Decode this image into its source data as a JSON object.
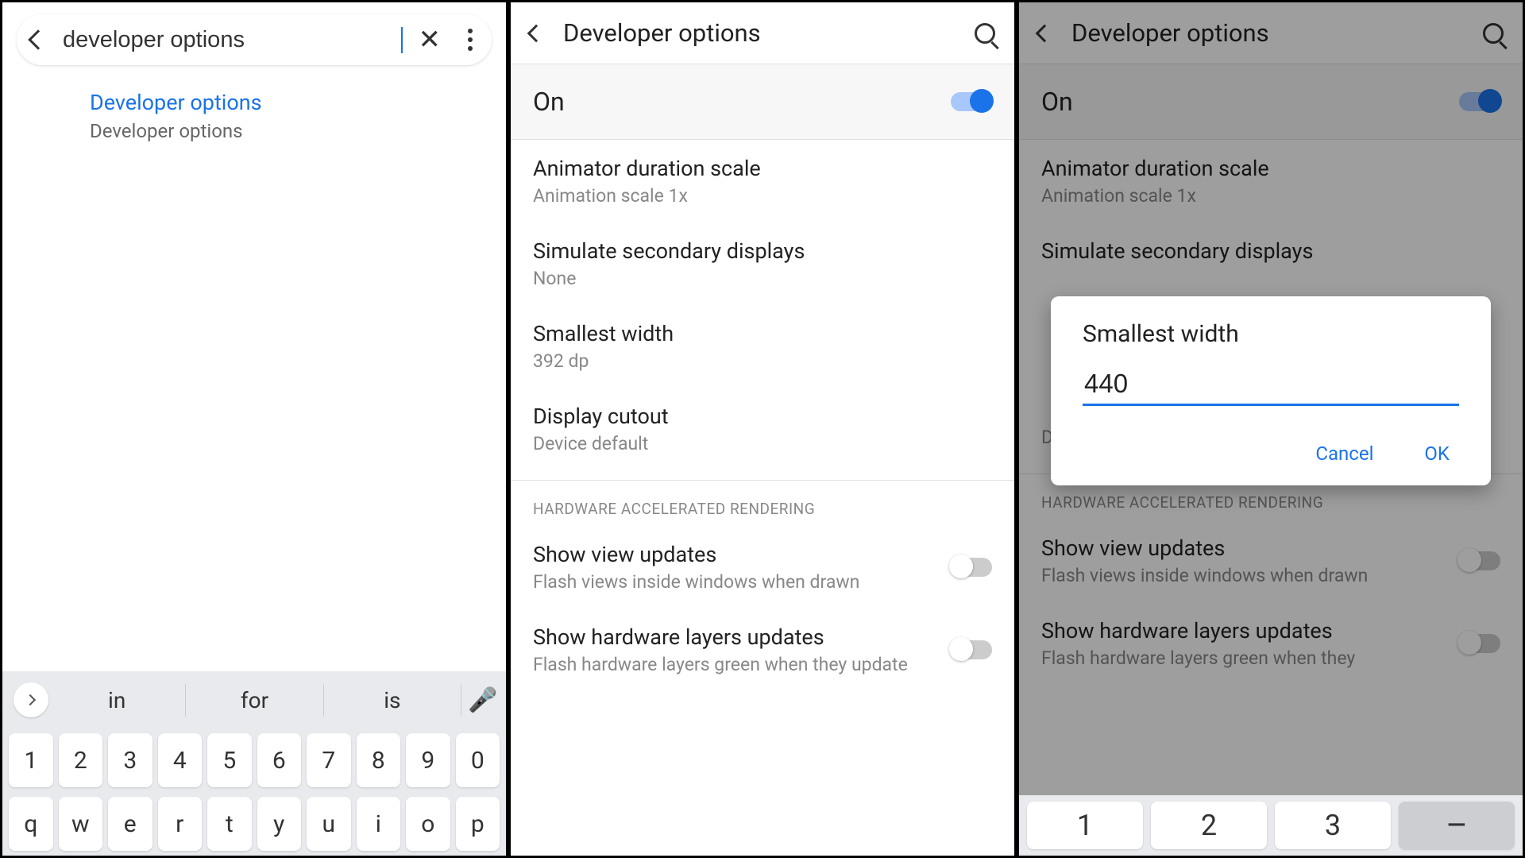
{
  "panel1": {
    "search_value": "developer options",
    "result_title": "Developer options",
    "result_sub": "Developer options",
    "suggestions": [
      "in",
      "for",
      "is"
    ],
    "num_row": [
      "1",
      "2",
      "3",
      "4",
      "5",
      "6",
      "7",
      "8",
      "9",
      "0"
    ],
    "letter_row": [
      "q",
      "w",
      "e",
      "r",
      "t",
      "y",
      "u",
      "i",
      "o",
      "p"
    ]
  },
  "panel2": {
    "title": "Developer options",
    "on_label": "On",
    "items": [
      {
        "title": "Animator duration scale",
        "sub": "Animation scale 1x"
      },
      {
        "title": "Simulate secondary displays",
        "sub": "None"
      },
      {
        "title": "Smallest width",
        "sub": "392 dp"
      },
      {
        "title": "Display cutout",
        "sub": "Device default"
      }
    ],
    "section_header": "HARDWARE ACCELERATED RENDERING",
    "toggle_items": [
      {
        "title": "Show view updates",
        "sub": "Flash views inside windows when drawn"
      },
      {
        "title": "Show hardware layers updates",
        "sub": "Flash hardware layers green when they update"
      }
    ]
  },
  "panel3": {
    "title": "Developer options",
    "on_label": "On",
    "items": [
      {
        "title": "Animator duration scale",
        "sub": "Animation scale 1x"
      },
      {
        "title": "Simulate secondary displays",
        "sub": ""
      },
      {
        "title": "",
        "sub": "Device default"
      }
    ],
    "section_header": "HARDWARE ACCELERATED RENDERING",
    "toggle_items": [
      {
        "title": "Show view updates",
        "sub": "Flash views inside windows when drawn"
      },
      {
        "title": "Show hardware layers updates",
        "sub": "Flash hardware layers green when they"
      }
    ],
    "dialog": {
      "title": "Smallest width",
      "value": "440",
      "cancel": "Cancel",
      "ok": "OK"
    },
    "numpad": [
      "1",
      "2",
      "3",
      "–"
    ]
  }
}
